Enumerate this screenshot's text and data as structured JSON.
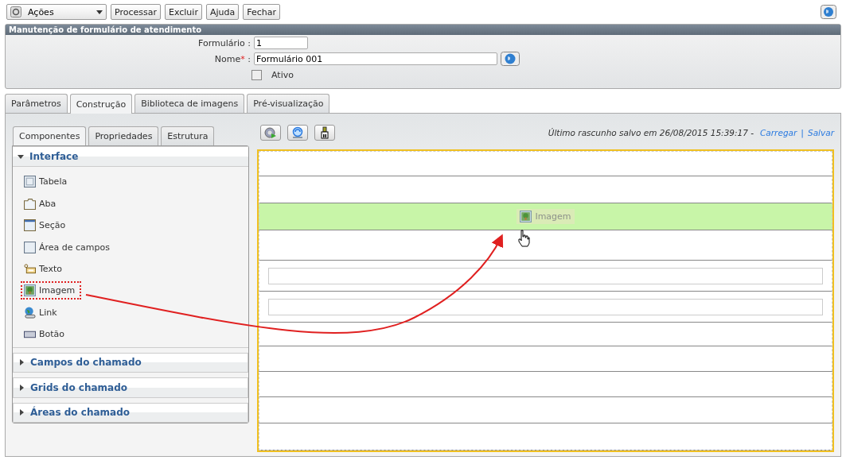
{
  "toolbar": {
    "actions_menu": "Ações",
    "buttons": [
      "Processar",
      "Excluir",
      "Ajuda",
      "Fechar"
    ]
  },
  "panel": {
    "title": "Manutenção de formulário de atendimento",
    "required_mark": "*",
    "fields": [
      {
        "label": "Formulário",
        "required": false,
        "separator": ":",
        "value": "1",
        "kind": "short"
      },
      {
        "label": "Nome",
        "required": true,
        "separator": ":",
        "value": "Formulário 001",
        "kind": "long"
      }
    ],
    "checkbox": {
      "label": "Ativo",
      "checked": false
    }
  },
  "tabs": [
    {
      "label": "Parâmetros",
      "selected": false
    },
    {
      "label": "Construção",
      "selected": true
    },
    {
      "label": "Biblioteca de imagens",
      "selected": false
    },
    {
      "label": "Pré-visualização",
      "selected": false
    }
  ],
  "side_tabs": [
    {
      "label": "Componentes",
      "selected": true
    },
    {
      "label": "Propriedades",
      "selected": false
    },
    {
      "label": "Estrutura",
      "selected": false
    }
  ],
  "sections": [
    {
      "title": "Interface",
      "expanded": true,
      "items": [
        {
          "label": "Tabela",
          "kind": "table",
          "highlighted": false
        },
        {
          "label": "Aba",
          "kind": "tab",
          "highlighted": false
        },
        {
          "label": "Seção",
          "kind": "section",
          "highlighted": false
        },
        {
          "label": "Área de campos",
          "kind": "area",
          "highlighted": false
        },
        {
          "label": "Texto",
          "kind": "text",
          "highlighted": false
        },
        {
          "label": "Imagem",
          "kind": "image",
          "highlighted": true
        },
        {
          "label": "Link",
          "kind": "link",
          "highlighted": false
        },
        {
          "label": "Botão",
          "kind": "button",
          "highlighted": false
        }
      ]
    },
    {
      "title": "Campos do chamado",
      "expanded": false
    },
    {
      "title": "Grids do chamado",
      "expanded": false
    },
    {
      "title": "Áreas do chamado",
      "expanded": false
    }
  ],
  "draft": {
    "text": "Último rascunho salvo em 26/08/2015 15:39:17 -",
    "load_link": "Carregar",
    "separator": "|",
    "save_link": "Salvar"
  },
  "canvas_rows": [
    {
      "kind": "empty"
    },
    {
      "kind": "empty"
    },
    {
      "kind": "drop",
      "label": "Imagem"
    },
    {
      "kind": "empty"
    },
    {
      "kind": "field"
    },
    {
      "kind": "field"
    },
    {
      "kind": "empty"
    },
    {
      "kind": "empty"
    },
    {
      "kind": "empty"
    },
    {
      "kind": "empty"
    },
    {
      "kind": "empty"
    }
  ]
}
